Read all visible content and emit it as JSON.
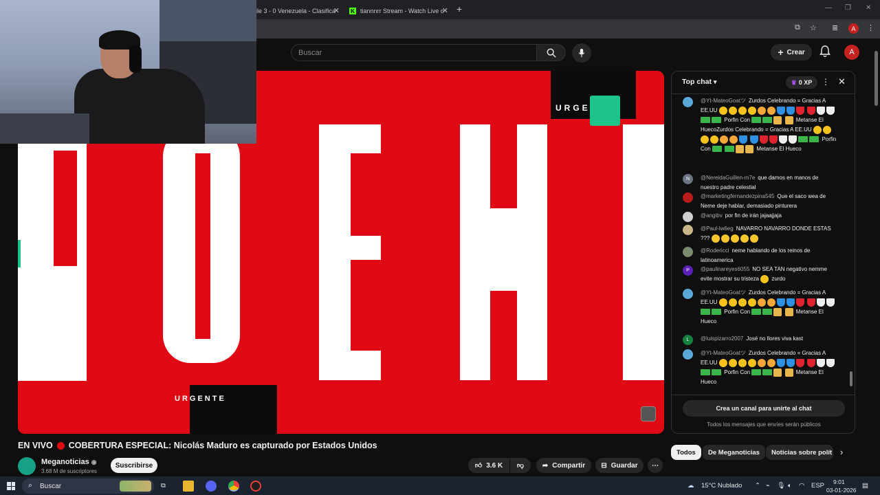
{
  "browser": {
    "tabs": [
      {
        "label": "ile 3 - 0 Venezuela - Clasifica"
      },
      {
        "label": "tiannnrr Stream - Watch Live o"
      }
    ]
  },
  "header": {
    "search_placeholder": "Buscar",
    "create_label": "Crear",
    "user_initial": "A"
  },
  "video": {
    "banner_top": "URGE",
    "banner_bottom": "URGENTE",
    "big_text": "RGENT"
  },
  "title": {
    "live": "EN VIVO",
    "text": "COBERTURA ESPECIAL: Nicolás Maduro es capturado por Estados Unidos"
  },
  "channel": {
    "name": "Meganoticias",
    "subs": "3.68 M de suscriptores",
    "subscribe": "Suscribirse"
  },
  "actions": {
    "likes": "3.6 K",
    "share": "Compartir",
    "save": "Guardar"
  },
  "chat": {
    "title": "Top chat",
    "xp": "0 XP",
    "messages": [
      {
        "author": "@Yt-MateoGoatツ",
        "text": "Zurdos Celebrando = Gracias A EE.UU",
        "avatar": "img",
        "color": "#5aa8d8"
      },
      {
        "author": "@NereidaGuillen-m7e",
        "text": "que damos en manos de nuestro padre celestial",
        "avatar": "N",
        "color": "#6b7280"
      },
      {
        "author": "@marketingfernandezpina545",
        "text": "Que el saco wea de Neme deje hablar, demasiado pinturera",
        "avatar": "img",
        "color": "#b91c1c"
      },
      {
        "author": "@angibv",
        "text": "por fin de irán jajaajjaja",
        "avatar": "img",
        "color": "#cfcfcf"
      },
      {
        "author": "@Paul-lw6eg",
        "text": "NAVARRO NAVARRO DONDE ESTAS ???",
        "avatar": "img",
        "color": "#c9b78a"
      },
      {
        "author": "@Rodericci",
        "text": "neme hablando de los reinos de latinoamerica",
        "avatar": "img",
        "color": "#7a8b6e"
      },
      {
        "author": "@paulinareyes6055",
        "text": "NO SEA TAN negativo nemme evite mostrar su tristeza",
        "text2": "zurdo",
        "avatar": "P",
        "color": "#5b21b6"
      },
      {
        "author": "@Yt-MateoGoatツ",
        "text": "Zurdos Celebrando = Gracias A EE.UU",
        "avatar": "img",
        "color": "#5aa8d8"
      },
      {
        "author": "@luispizarro2007",
        "text": "José no llores viva kast",
        "avatar": "L",
        "color": "#15803d"
      },
      {
        "author": "@Yt-MateoGoatツ",
        "text": "Zurdos Celebrando = Gracias A EE.UU",
        "avatar": "img",
        "color": "#5aa8d8"
      }
    ],
    "emoji_words": {
      "porfin": "Porfin Con",
      "metanse": "Metanse El Hueco",
      "metanse_zurdos": "Metanse El HuecoZurdos Celebrando =",
      "gracias": "Gracias A EE.UU"
    },
    "create_channel": "Crea un canal para unirte al chat",
    "public_note": "Todos los mensajes que envíes serán públicos"
  },
  "chips": [
    "Todos",
    "De Meganoticias",
    "Noticias sobre polít"
  ],
  "taskbar": {
    "search": "Buscar",
    "weather": "15°C  Nublado",
    "lang": "ESP",
    "time": "9:01",
    "date": "03-01-2026"
  }
}
